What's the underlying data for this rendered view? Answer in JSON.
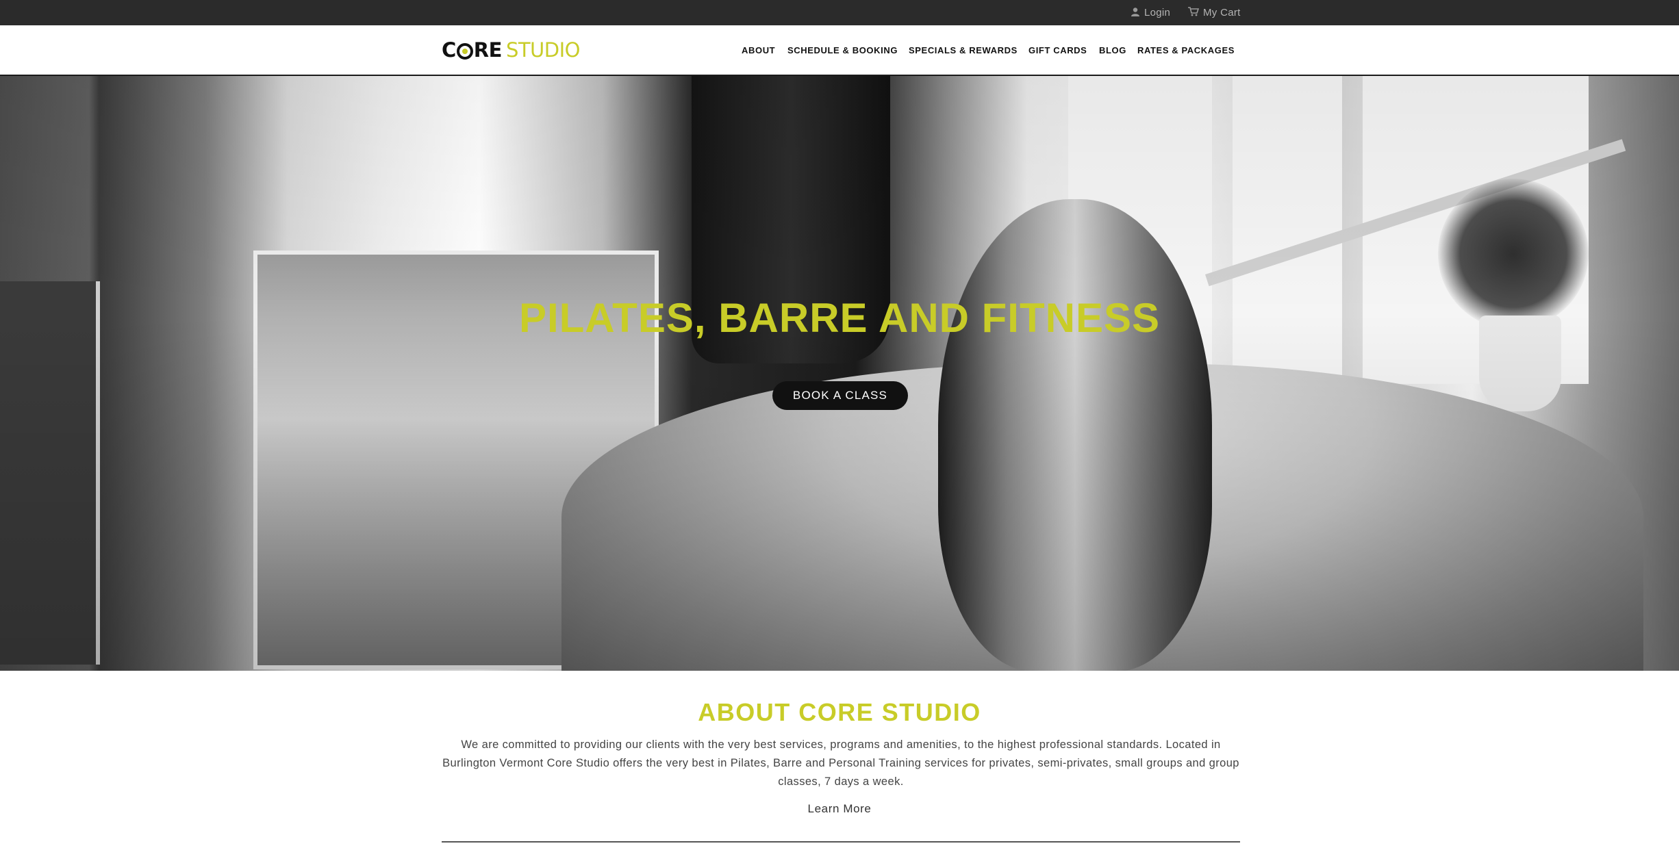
{
  "topbar": {
    "login_label": "Login",
    "cart_label": "My Cart",
    "login_icon": "user-icon",
    "cart_icon": "cart-icon"
  },
  "header": {
    "logo_core": "CORE",
    "logo_studio": "STUDIO",
    "nav": [
      "ABOUT",
      "SCHEDULE & BOOKING",
      "SPECIALS & REWARDS",
      "GIFT CARDS",
      "BLOG",
      "RATES & PACKAGES"
    ]
  },
  "hero": {
    "title": "PILATES, BARRE AND FITNESS",
    "button_label": "BOOK A CLASS"
  },
  "about": {
    "title": "ABOUT CORE STUDIO",
    "text": "We are committed to providing our clients with the very best services, programs and amenities, to the highest professional standards. Located in Burlington Vermont Core Studio offers the very best in Pilates, Barre and Personal Training services for privates, semi-privates, small groups and group classes, 7 days a week.",
    "link_label": "Learn More"
  },
  "colors": {
    "accent": "#c8cc28",
    "topbar_bg": "#2b2b2b",
    "button_bg": "#111111"
  }
}
